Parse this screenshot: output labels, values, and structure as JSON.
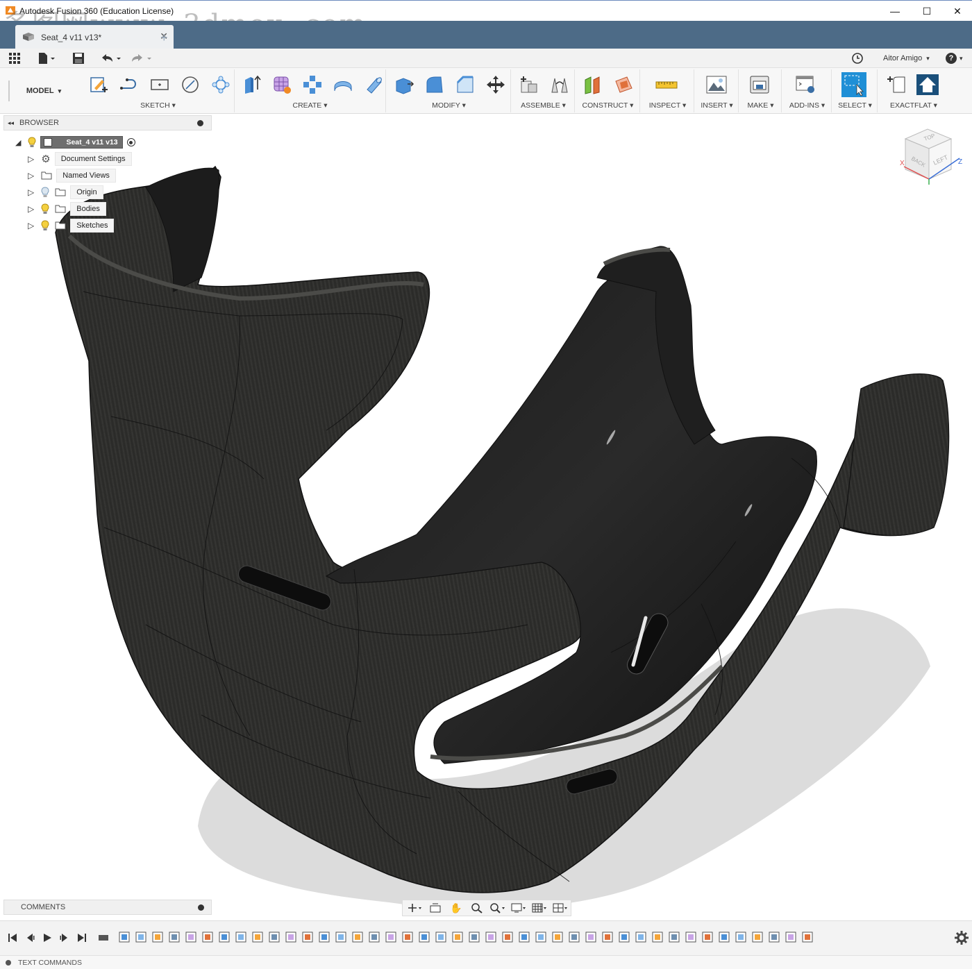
{
  "window": {
    "title": "Autodesk Fusion 360 (Education License)",
    "watermark": "多图网www. 3dmox. com",
    "minimize_glyph": "—",
    "maximize_glyph": "☐",
    "close_glyph": "✕"
  },
  "tabs": {
    "active_label": "Seat_4 v11 v13*",
    "close_glyph": "✕",
    "new_glyph": "+"
  },
  "quick_access": {
    "user": "Aitor Amigo",
    "user_caret": "▾",
    "help_glyph": "?",
    "help_caret": "▾"
  },
  "toolbar": {
    "workspace": "MODEL",
    "workspace_caret": "▾",
    "groups": [
      {
        "label": "SKETCH ▾"
      },
      {
        "label": "CREATE ▾"
      },
      {
        "label": "MODIFY ▾"
      },
      {
        "label": "ASSEMBLE ▾"
      },
      {
        "label": "CONSTRUCT ▾"
      },
      {
        "label": "INSPECT ▾"
      },
      {
        "label": "INSERT ▾"
      },
      {
        "label": "MAKE ▾"
      },
      {
        "label": "ADD-INS ▾"
      },
      {
        "label": "SELECT ▾"
      },
      {
        "label": "EXACTFLAT ▾"
      }
    ],
    "accent": "#1f8fd6"
  },
  "browser": {
    "title": "BROWSER",
    "root": "Seat_4 v11 v13",
    "items": [
      {
        "label": "Document Settings",
        "icon": "gear-icon"
      },
      {
        "label": "Named Views",
        "icon": "folder-icon"
      },
      {
        "label": "Origin",
        "icon": "folder-icon"
      },
      {
        "label": "Bodies",
        "icon": "folder-icon"
      },
      {
        "label": "Sketches",
        "icon": "folder-icon"
      }
    ]
  },
  "viewcube": {
    "top": "TOP",
    "back": "BACK",
    "left": "LEFT",
    "x": "X",
    "z": "Z"
  },
  "comments": {
    "title": "COMMENTS"
  },
  "text_commands": {
    "label": "TEXT COMMANDS"
  },
  "colors": {
    "tabbar": "#4d6b87",
    "model": "#2b2b2b",
    "shadow": "#d9d9d9"
  }
}
